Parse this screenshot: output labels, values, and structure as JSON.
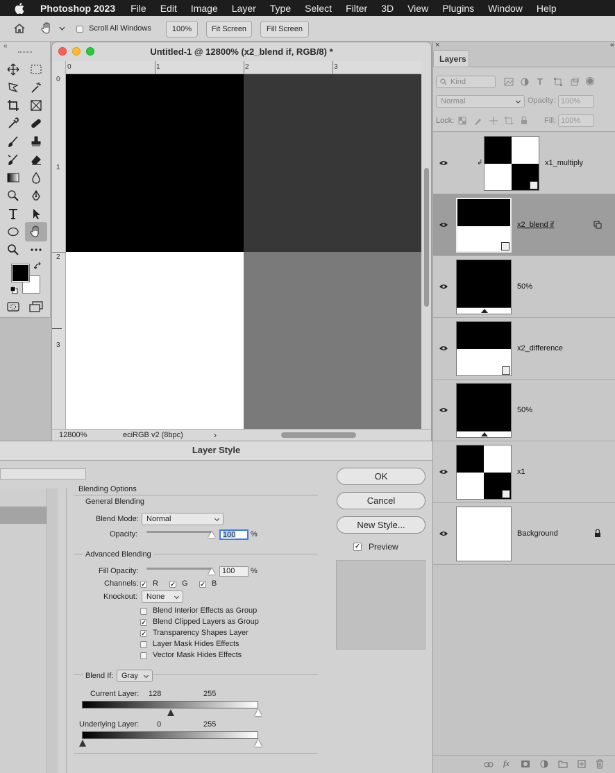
{
  "menubar": {
    "app_name": "Photoshop 2023",
    "items": [
      "File",
      "Edit",
      "Image",
      "Layer",
      "Type",
      "Select",
      "Filter",
      "3D",
      "View",
      "Plugins",
      "Window",
      "Help"
    ]
  },
  "options_bar": {
    "scroll_all_windows": "Scroll All Windows",
    "zoom_100": "100%",
    "fit_screen": "Fit Screen",
    "fill_screen": "Fill Screen"
  },
  "document": {
    "title": "Untitled-1 @ 12800% (x2_blend if, RGB/8) *",
    "h_ruler": [
      "0",
      "1",
      "2",
      "3"
    ],
    "v_ruler": [
      "0",
      "1",
      "2",
      "3"
    ],
    "zoom_status": "12800%",
    "color_profile": "eciRGB v2 (8bpc)",
    "status_arrow": "›"
  },
  "layers_panel": {
    "tab": "Layers",
    "filter_kind": "Kind",
    "blend_mode": "Normal",
    "opacity_label": "Opacity:",
    "opacity_value": "100%",
    "lock_label": "Lock:",
    "fill_label": "Fill:",
    "fill_value": "100%",
    "layers": [
      {
        "name": "x1_multiply",
        "selected": false
      },
      {
        "name": "x2_blend if",
        "selected": true
      },
      {
        "name": "50%",
        "selected": false
      },
      {
        "name": "x2_difference",
        "selected": false
      },
      {
        "name": "50%",
        "selected": false
      },
      {
        "name": "x1",
        "selected": false
      },
      {
        "name": "Background",
        "selected": false
      }
    ]
  },
  "layer_style": {
    "title": "Layer Style",
    "ok": "OK",
    "cancel": "Cancel",
    "new_style": "New Style...",
    "preview": "Preview",
    "blending_options": "Blending Options",
    "general_blending": "General Blending",
    "blend_mode_label": "Blend Mode:",
    "blend_mode_value": "Normal",
    "opacity_label": "Opacity:",
    "opacity_value": "100",
    "percent": "%",
    "advanced_blending": "Advanced Blending",
    "fill_opacity_label": "Fill Opacity:",
    "fill_opacity_value": "100",
    "channels_label": "Channels:",
    "channel_r": "R",
    "channel_g": "G",
    "channel_b": "B",
    "knockout_label": "Knockout:",
    "knockout_value": "None",
    "options": [
      {
        "label": "Blend Interior Effects as Group",
        "checked": false
      },
      {
        "label": "Blend Clipped Layers as Group",
        "checked": true
      },
      {
        "label": "Transparency Shapes Layer",
        "checked": true
      },
      {
        "label": "Layer Mask Hides Effects",
        "checked": false
      },
      {
        "label": "Vector Mask Hides Effects",
        "checked": false
      }
    ],
    "blend_if_label": "Blend If:",
    "blend_if_value": "Gray",
    "current_layer_label": "Current Layer:",
    "current_layer_low": "128",
    "current_layer_high": "255",
    "underlying_layer_label": "Underlying Layer:",
    "underlying_layer_low": "0",
    "underlying_layer_high": "255"
  }
}
